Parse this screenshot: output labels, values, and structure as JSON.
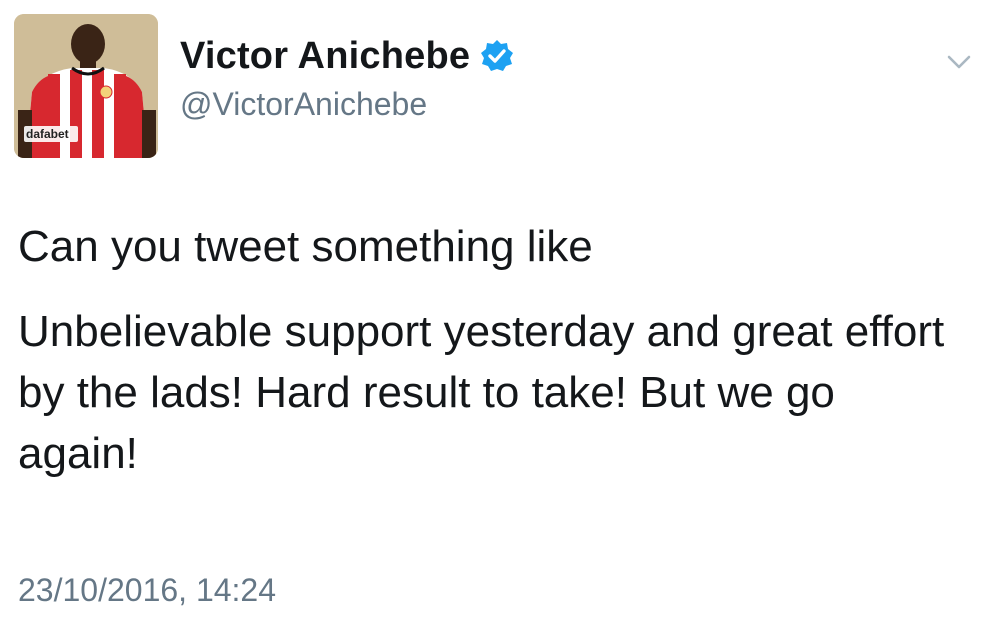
{
  "tweet": {
    "author": {
      "display_name": "Victor Anichebe",
      "handle": "@VictorAnichebe",
      "verified": true,
      "avatar_sponsor_text": "dafabet"
    },
    "text_line_1": "Can you tweet something like",
    "text_line_2": "Unbelievable support yesterday and great effort by the lads! Hard result to take! But we go again!",
    "timestamp": "23/10/2016, 14:24",
    "icons": {
      "verified": "verified-badge-icon",
      "menu": "chevron-down-icon"
    },
    "colors": {
      "verified_blue": "#1da1f2",
      "secondary_text": "#657786",
      "primary_text": "#14171a",
      "jersey_red": "#d7282f"
    }
  }
}
